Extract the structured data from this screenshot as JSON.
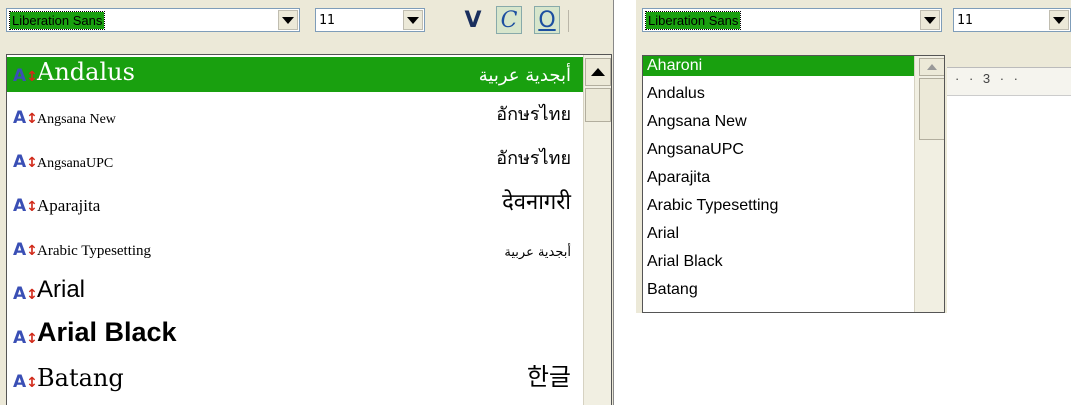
{
  "left_toolbar": {
    "font_name": "Liberation Sans",
    "font_size": "11",
    "bold_label": "V",
    "italic_label": "C",
    "underline_label": "O",
    "dropdown_icon": "chevron-down-icon"
  },
  "left_font_list": [
    {
      "name": "Andalus",
      "sample": "أبجدية عربية",
      "selected": true
    },
    {
      "name": "Angsana New",
      "sample": "อักษรไทย"
    },
    {
      "name": "AngsanaUPC",
      "sample": "อักษรไทย"
    },
    {
      "name": "Aparajita",
      "sample": "देवनागरी"
    },
    {
      "name": "Arabic Typesetting",
      "sample": "أبجدية عربية"
    },
    {
      "name": "Arial",
      "sample": ""
    },
    {
      "name": "Arial Black",
      "sample": ""
    },
    {
      "name": "Batang",
      "sample": "한글"
    }
  ],
  "right_toolbar": {
    "font_name": "Liberation Sans",
    "font_size": "11"
  },
  "right_font_list": [
    {
      "name": "Aharoni",
      "selected": true
    },
    {
      "name": "Andalus"
    },
    {
      "name": "Angsana New"
    },
    {
      "name": "AngsanaUPC"
    },
    {
      "name": "Aparajita"
    },
    {
      "name": "Arabic Typesetting"
    },
    {
      "name": "Arial"
    },
    {
      "name": "Arial Black"
    },
    {
      "name": "Batang"
    }
  ],
  "ruler": {
    "marks": "· · 3 · ·"
  },
  "colors": {
    "selection": "#19a00f",
    "font_icon_blue": "#3a4fb5",
    "font_icon_red": "#d12a1a"
  }
}
